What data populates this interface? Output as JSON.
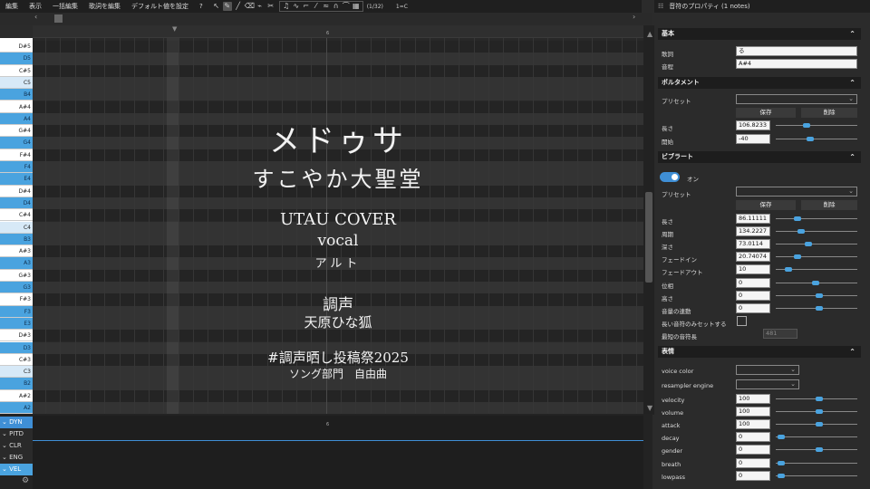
{
  "menu": {
    "items": [
      "編集",
      "表示",
      "一括編集",
      "歌詞を編集",
      "デフォルト値を設定",
      "?"
    ],
    "snap": "(1/32)",
    "toggle": "1=C"
  },
  "ruler": {
    "measure": "6",
    "lower_measure": "6"
  },
  "piano_keys": [
    {
      "label": "D#5",
      "type": "white"
    },
    {
      "label": "D5",
      "type": "blue"
    },
    {
      "label": "C#5",
      "type": "white"
    },
    {
      "label": "C5",
      "type": "light"
    },
    {
      "label": "B4",
      "type": "blue"
    },
    {
      "label": "A#4",
      "type": "white"
    },
    {
      "label": "A4",
      "type": "blue"
    },
    {
      "label": "G#4",
      "type": "white"
    },
    {
      "label": "G4",
      "type": "blue"
    },
    {
      "label": "F#4",
      "type": "white"
    },
    {
      "label": "F4",
      "type": "blue"
    },
    {
      "label": "E4",
      "type": "blue"
    },
    {
      "label": "D#4",
      "type": "white"
    },
    {
      "label": "D4",
      "type": "blue"
    },
    {
      "label": "C#4",
      "type": "white"
    },
    {
      "label": "C4",
      "type": "light"
    },
    {
      "label": "B3",
      "type": "blue"
    },
    {
      "label": "A#3",
      "type": "white"
    },
    {
      "label": "A3",
      "type": "blue"
    },
    {
      "label": "G#3",
      "type": "white"
    },
    {
      "label": "G3",
      "type": "blue"
    },
    {
      "label": "F#3",
      "type": "white"
    },
    {
      "label": "F3",
      "type": "blue"
    },
    {
      "label": "E3",
      "type": "blue"
    },
    {
      "label": "D#3",
      "type": "white"
    },
    {
      "label": "D3",
      "type": "blue"
    },
    {
      "label": "C#3",
      "type": "white"
    },
    {
      "label": "C3",
      "type": "light"
    },
    {
      "label": "B2",
      "type": "blue"
    },
    {
      "label": "A#2",
      "type": "white"
    },
    {
      "label": "A2",
      "type": "blue"
    }
  ],
  "overlay": {
    "title": "メドゥサ",
    "artist": "すこやか大聖堂",
    "cover": "UTAU COVER",
    "vocal": "vocal",
    "voice_type": "アルト",
    "tuning_label": "調声",
    "tuner": "天原ひな狐",
    "hashtag": "#調声晒し投稿祭2025",
    "category": "ソング部門　自由曲"
  },
  "expressions": [
    "DYN",
    "PITD",
    "CLR",
    "ENG",
    "VEL"
  ],
  "panel": {
    "title": "音符のプロパティ (1 notes)",
    "basic": {
      "header": "基本",
      "lyric_label": "歌詞",
      "lyric": "る",
      "tone_label": "音程",
      "tone": "A#4"
    },
    "portamento": {
      "header": "ポルタメント",
      "preset_label": "プリセット",
      "save": "保存",
      "delete": "削除",
      "length_label": "長さ",
      "length": "106.8233",
      "start_label": "開始",
      "start": "-40"
    },
    "vibrato": {
      "header": "ビブラート",
      "on_label": "オン",
      "preset_label": "プリセット",
      "save": "保存",
      "delete": "削除",
      "fields": [
        {
          "label": "長さ",
          "value": "86.11111"
        },
        {
          "label": "周期",
          "value": "134.2227"
        },
        {
          "label": "深さ",
          "value": "73.0114"
        },
        {
          "label": "フェードイン",
          "value": "20.74074"
        },
        {
          "label": "フェードアウト",
          "value": "10"
        },
        {
          "label": "位相",
          "value": "0"
        },
        {
          "label": "高さ",
          "value": "0"
        },
        {
          "label": "音量の連動",
          "value": "0"
        }
      ],
      "long_note_label": "長い音符のみセットする",
      "min_length_label": "最短の音符長",
      "min_length": "481"
    },
    "expressions": {
      "header": "表情",
      "voice_color_label": "voice color",
      "resampler_label": "resampler engine",
      "fields": [
        {
          "label": "velocity",
          "value": "100"
        },
        {
          "label": "volume",
          "value": "100"
        },
        {
          "label": "attack",
          "value": "100"
        },
        {
          "label": "decay",
          "value": "0"
        },
        {
          "label": "gender",
          "value": "0"
        },
        {
          "label": "breath",
          "value": "0"
        },
        {
          "label": "lowpass",
          "value": "0"
        }
      ]
    }
  }
}
